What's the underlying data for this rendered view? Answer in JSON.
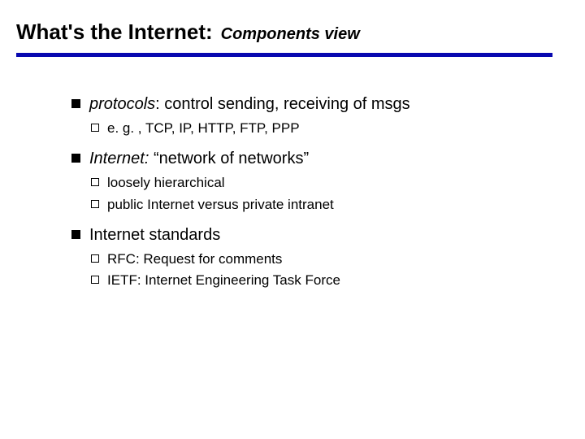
{
  "title": {
    "main": "What's the Internet:",
    "sub": "Components view"
  },
  "bullets": [
    {
      "lead_italic": "protocols",
      "rest": ": control sending, receiving of msgs",
      "subs": [
        "e. g. , TCP, IP, HTTP, FTP,  PPP"
      ]
    },
    {
      "lead_italic": "Internet:",
      "rest": " “network of networks”",
      "subs": [
        "loosely hierarchical",
        "public Internet versus private intranet"
      ]
    },
    {
      "lead_italic": "",
      "rest": "Internet standards",
      "subs": [
        "RFC: Request for comments",
        "IETF: Internet Engineering Task Force"
      ]
    }
  ]
}
